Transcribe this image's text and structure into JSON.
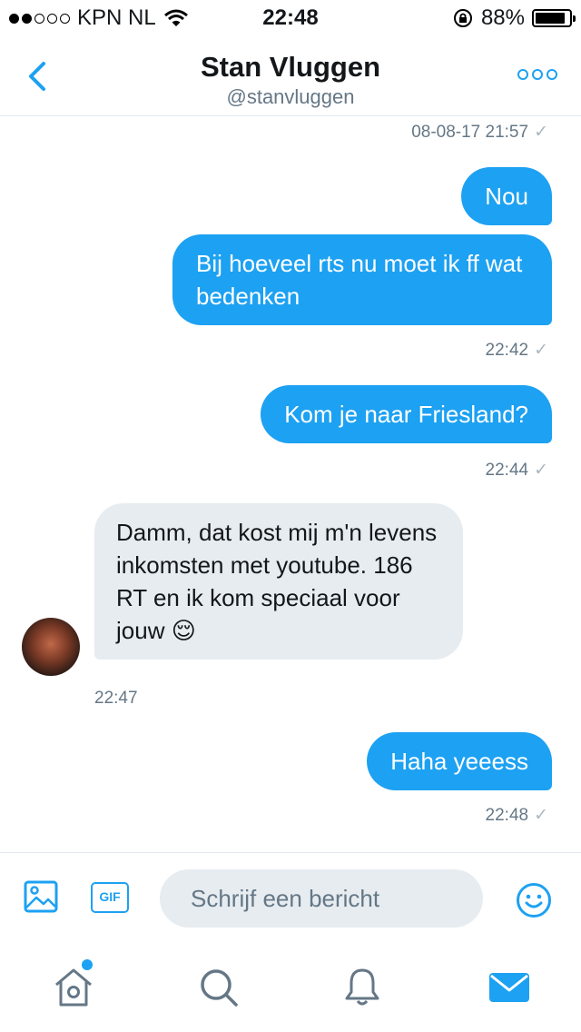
{
  "status_bar": {
    "carrier": "KPN NL",
    "time": "22:48",
    "battery_percent": "88%",
    "battery_level": 0.88,
    "signal_bars": 2,
    "signal_total": 5
  },
  "header": {
    "name": "Stan Vluggen",
    "handle": "@stanvluggen"
  },
  "messages": [
    {
      "type": "timestamp",
      "text": "08-08-17 21:57"
    },
    {
      "type": "outgoing",
      "text": "Nou"
    },
    {
      "type": "outgoing",
      "text": "Bij hoeveel rts nu moet ik ff wat bedenken"
    },
    {
      "type": "timestamp",
      "text": "22:42"
    },
    {
      "type": "outgoing",
      "text": "Kom je naar Friesland?"
    },
    {
      "type": "timestamp",
      "text": "22:44"
    },
    {
      "type": "incoming",
      "text": "Damm, dat kost mij m'n levens inkomsten met youtube. 186 RT en ik kom speciaal voor jouw 😌"
    },
    {
      "type": "timestamp",
      "text": "22:47"
    },
    {
      "type": "outgoing",
      "text": "Haha yeeess"
    },
    {
      "type": "timestamp",
      "text": "22:48"
    }
  ],
  "composer": {
    "placeholder": "Schrijf een bericht",
    "gif_label": "GIF"
  },
  "icons": {
    "back": "chevron-left-icon",
    "more": "more-horizontal-icon",
    "media": "image-icon",
    "gif": "gif-icon",
    "emoji": "smiley-icon",
    "home": "home-icon",
    "search": "search-icon",
    "notifications": "bell-icon",
    "messages": "mail-icon"
  },
  "colors": {
    "accent": "#1da1f2",
    "incoming_bubble": "#e6ecf0",
    "secondary_text": "#657786"
  }
}
